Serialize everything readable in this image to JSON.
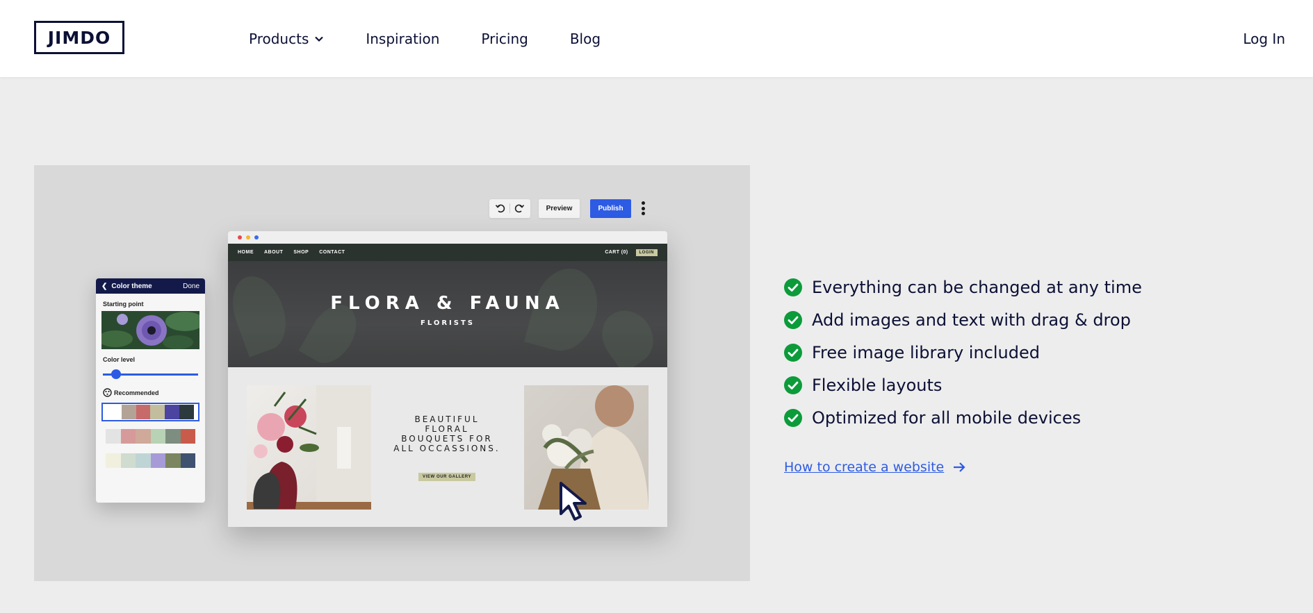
{
  "header": {
    "logo_text": "JIMDO",
    "nav": [
      {
        "label": "Products",
        "has_dropdown": true
      },
      {
        "label": "Inspiration"
      },
      {
        "label": "Pricing"
      },
      {
        "label": "Blog"
      }
    ],
    "login_label": "Log In"
  },
  "illustration": {
    "toolbar": {
      "preview_label": "Preview",
      "publish_label": "Publish"
    },
    "site": {
      "nav_links": [
        "HOME",
        "ABOUT",
        "SHOP",
        "CONTACT"
      ],
      "cart_label": "CART (0)",
      "login_label": "LOGIN",
      "hero_title": "FLORA & FAUNA",
      "hero_subtitle": "FLORISTS",
      "tagline_lines": [
        "BEAUTIFUL",
        "FLORAL",
        "BOUQUETS FOR",
        "ALL OCCASSIONS."
      ],
      "gallery_button": "VIEW OUR GALLERY"
    },
    "theme_panel": {
      "title": "Color theme",
      "done_label": "Done",
      "starting_point_label": "Starting point",
      "color_level_label": "Color level",
      "color_level_value": 0.1,
      "recommended_label": "Recommended",
      "palettes": [
        [
          "#ffffff",
          "#b3a396",
          "#c76a6a",
          "#c2bd9c",
          "#4b44a1",
          "#2c3a3d"
        ],
        [
          "#e3e3e3",
          "#d69a9a",
          "#cfa99a",
          "#b7d2b4",
          "#7d8d80",
          "#c95b4b"
        ],
        [
          "#f1f0df",
          "#cfdccf",
          "#bfd5d5",
          "#a69bd6",
          "#7b8560",
          "#3f5270"
        ]
      ]
    },
    "colors": {
      "publish": "#2d5be3",
      "theme_header": "#131a4a",
      "site_nav": "#2b332f"
    }
  },
  "features": {
    "items": [
      "Everything can be changed at any time",
      "Add images and text with drag & drop",
      "Free image library included",
      "Flexible layouts",
      "Optimized for all mobile devices"
    ],
    "check_color": "#0c9b3a",
    "cta_label": "How to create a website"
  }
}
